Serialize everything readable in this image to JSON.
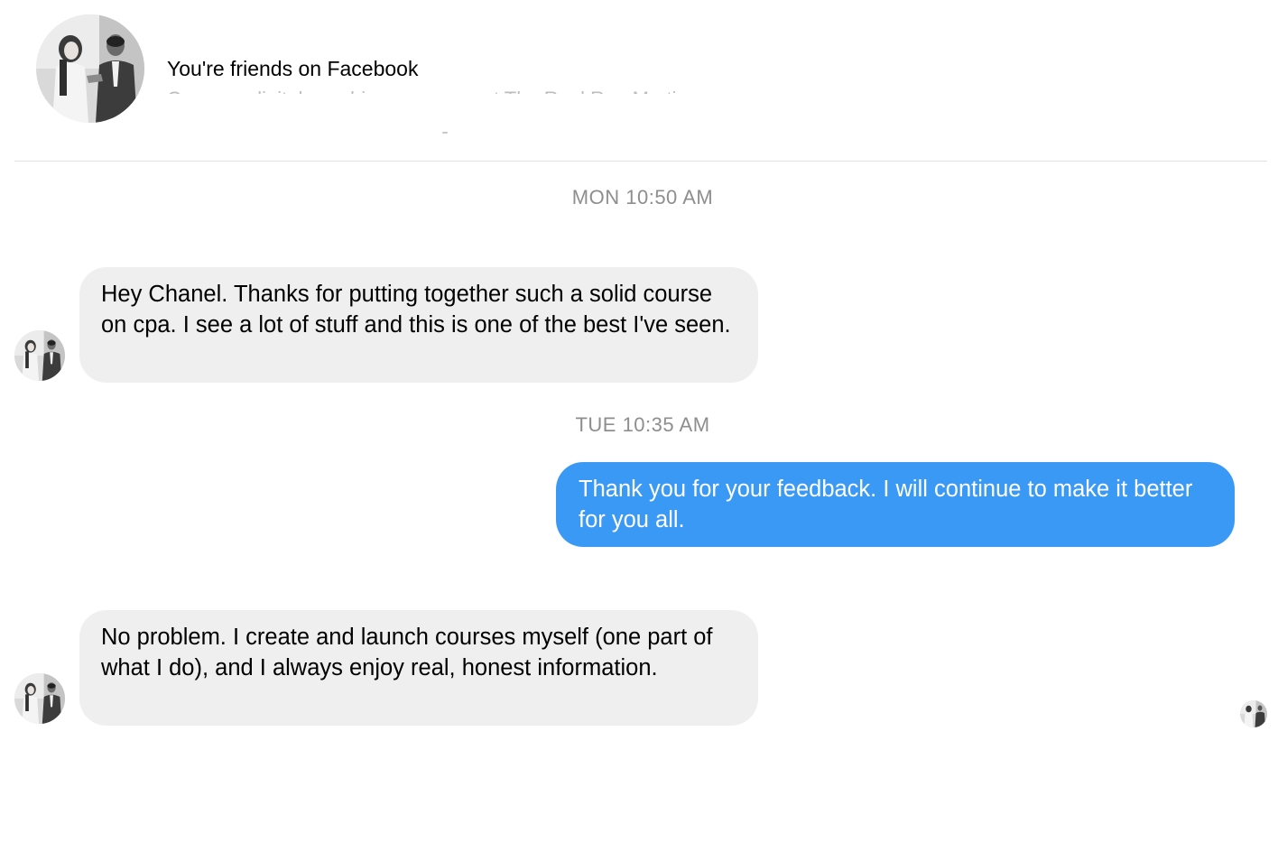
{
  "header": {
    "friends_text": "You're friends on Facebook",
    "subtext": "Co-owns digital coaching programs at The Real Rae Martin"
  },
  "conversation": {
    "timestamps": [
      "MON 10:50 AM",
      "TUE 10:35 AM"
    ],
    "messages": [
      {
        "direction": "incoming",
        "text": "Hey Chanel. Thanks for putting together such a solid course on cpa. I see a lot of stuff and this is one of the best I've seen."
      },
      {
        "direction": "outgoing",
        "text": "Thank you for your feedback. I will continue to make it better for you all."
      },
      {
        "direction": "incoming",
        "text": "No problem. I create and launch courses myself (one part of what I do), and I always enjoy real, honest information."
      }
    ]
  },
  "colors": {
    "incoming_bubble": "#efefef",
    "outgoing_bubble": "#3a99f4",
    "timestamp": "#8e8e8e",
    "divider": "#e2e2e2"
  },
  "icons": {
    "contact_avatar": "couple-photo-avatar",
    "read_receipt": "read-receipt-avatar"
  }
}
